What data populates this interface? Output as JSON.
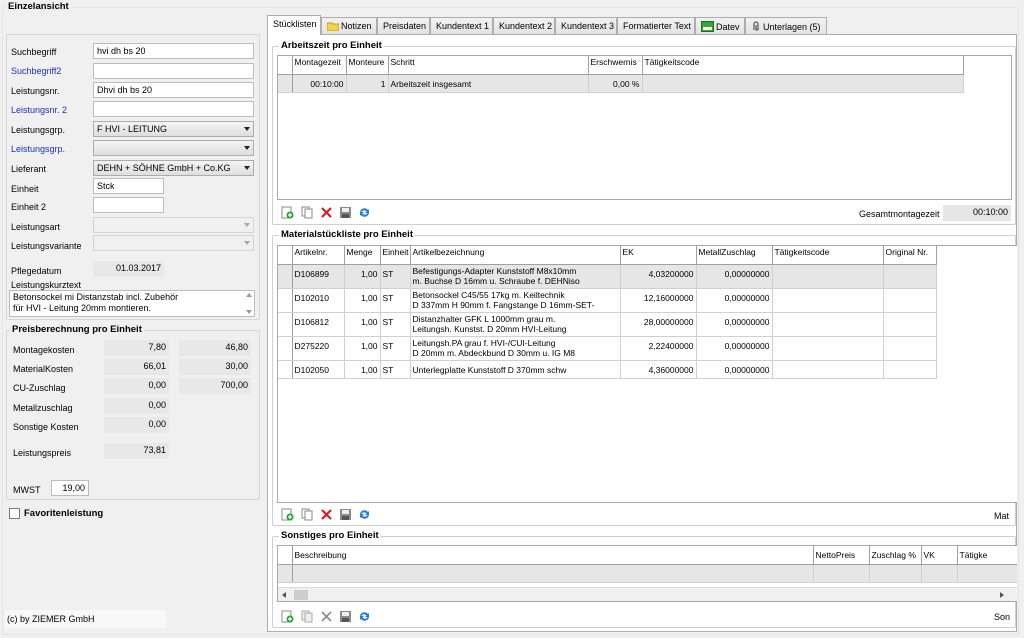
{
  "left": {
    "group_title": "Einzelansicht",
    "fields": {
      "suchbegriff": {
        "label": "Suchbegriff",
        "value": "hvi dh bs 20"
      },
      "suchbegriff2": {
        "label": "Suchbegriff2",
        "value": ""
      },
      "leistungsnr": {
        "label": "Leistungsnr.",
        "value": "Dhvi dh bs 20"
      },
      "leistungsnr2": {
        "label": "Leistungsnr. 2",
        "value": ""
      },
      "leistungsgrp": {
        "label": "Leistungsgrp.",
        "value": "F HVI - LEITUNG"
      },
      "leistungsgrp2": {
        "label": "Leistungsgrp.",
        "value": ""
      },
      "lieferant": {
        "label": "Lieferant",
        "value": "DEHN + SÖHNE GmbH + Co.KG"
      },
      "einheit": {
        "label": "Einheit",
        "value": "Stck"
      },
      "einheit2": {
        "label": "Einheit 2",
        "value": ""
      },
      "leistungsart": {
        "label": "Leistungsart",
        "value": ""
      },
      "leistungsvariante": {
        "label": "Leistungsvariante",
        "value": ""
      },
      "pflegedatum": {
        "label": "Pflegedatum",
        "value": "01.03.2017"
      },
      "kurztext": {
        "label": "Leistungskurztext",
        "line1": "Betonsockel mi Distanzstab incl. Zubehör",
        "line2": "für HVI - Leitung 20mm montieren."
      }
    },
    "preis": {
      "title": "Preisberechnung pro Einheit",
      "rows": [
        {
          "label": "Montagekosten",
          "v1": "7,80",
          "v2": "46,80"
        },
        {
          "label": "MaterialKosten",
          "v1": "66,01",
          "v2": "30,00"
        },
        {
          "label": "CU-Zuschlag",
          "v1": "0,00",
          "v2": "700,00"
        },
        {
          "label": "Metallzuschlag",
          "v1": "0,00",
          "v2": ""
        },
        {
          "label": "Sonstige Kosten",
          "v1": "0,00",
          "v2": ""
        }
      ],
      "leistungspreis_label": "Leistungspreis",
      "leistungspreis": "73,81",
      "mwst_label": "MWST",
      "mwst": "19,00"
    },
    "favoriten": "Favoritenleistung",
    "copyright": "(c) by ZIEMER GmbH"
  },
  "tabs": [
    {
      "label": "Stücklisten",
      "icon": ""
    },
    {
      "label": "Notizen",
      "icon": "folder-icon"
    },
    {
      "label": "Preisdaten",
      "icon": ""
    },
    {
      "label": "Kundentext 1",
      "icon": ""
    },
    {
      "label": "Kundentext 2",
      "icon": ""
    },
    {
      "label": "Kundentext 3",
      "icon": ""
    },
    {
      "label": "Formatierter Text",
      "icon": ""
    },
    {
      "label": "Datev",
      "icon": "datev-icon"
    },
    {
      "label": "Unterlagen (5)",
      "icon": "paperclip-icon"
    }
  ],
  "arbeitszeit": {
    "title": "Arbeitszeit pro Einheit",
    "columns": [
      "Montagezeit",
      "Monteure",
      "Schritt",
      "Erschwernis",
      "Tätigkeitscode"
    ],
    "rows": [
      [
        "00:10:00",
        "1",
        "Arbeitszeit insgesamt",
        "0,00 %",
        ""
      ]
    ],
    "total_label": "Gesamtmontagezeit",
    "total": "00:10:00"
  },
  "material": {
    "title": "Materialstückliste pro Einheit",
    "columns": [
      "Artikelnr.",
      "Menge",
      "Einheit",
      "Artikelbezeichnung",
      "EK",
      "MetallZuschlag",
      "Tätigkeitscode",
      "Original Nr."
    ],
    "rows": [
      {
        "nr": "D106899",
        "menge": "1,00",
        "einheit": "ST",
        "bez1": "Befestigungs-Adapter Kunststoff M8x10mm",
        "bez2": "m. Buchse D 16mm u. Schraube f. DEHNiso",
        "ek": "4,03200000",
        "mz": "0,00000000"
      },
      {
        "nr": "D102010",
        "menge": "1,00",
        "einheit": "ST",
        "bez1": "Betonsockel C45/55 17kg m. Keiltechnik",
        "bez2": "D 337mm H 90mm f. Fangstange D 16mm-SET-",
        "ek": "12,16000000",
        "mz": "0,00000000"
      },
      {
        "nr": "D106812",
        "menge": "1,00",
        "einheit": "ST",
        "bez1": "Distanzhalter GFK L 1000mm grau m.",
        "bez2": "Leitungsh. Kunstst. D 20mm HVI-Leitung",
        "ek": "28,00000000",
        "mz": "0,00000000"
      },
      {
        "nr": "D275220",
        "menge": "1,00",
        "einheit": "ST",
        "bez1": "Leitungsh.PA grau f. HVI-/CUI-Leitung",
        "bez2": "D 20mm m. Abdeckbund D 30mm u. IG M8",
        "ek": "2,22400000",
        "mz": "0,00000000"
      },
      {
        "nr": "D102050",
        "menge": "1,00",
        "einheit": "ST",
        "bez1": "Unterlegplatte Kunststoff D 370mm schw",
        "bez2": "",
        "ek": "4,36000000",
        "mz": "0,00000000"
      }
    ],
    "footer_right": "Mat"
  },
  "sonstiges": {
    "title": "Sonstiges pro Einheit",
    "columns": [
      "Beschreibung",
      "NettoPreis",
      "Zuschlag %",
      "VK",
      "Tätigke"
    ],
    "footer_right": "Son"
  },
  "colors": {
    "label_blue": "#1e2fb8",
    "delete_red": "#d42020",
    "add_green": "#2e9e2e",
    "refresh_blue": "#2a7fd4"
  }
}
